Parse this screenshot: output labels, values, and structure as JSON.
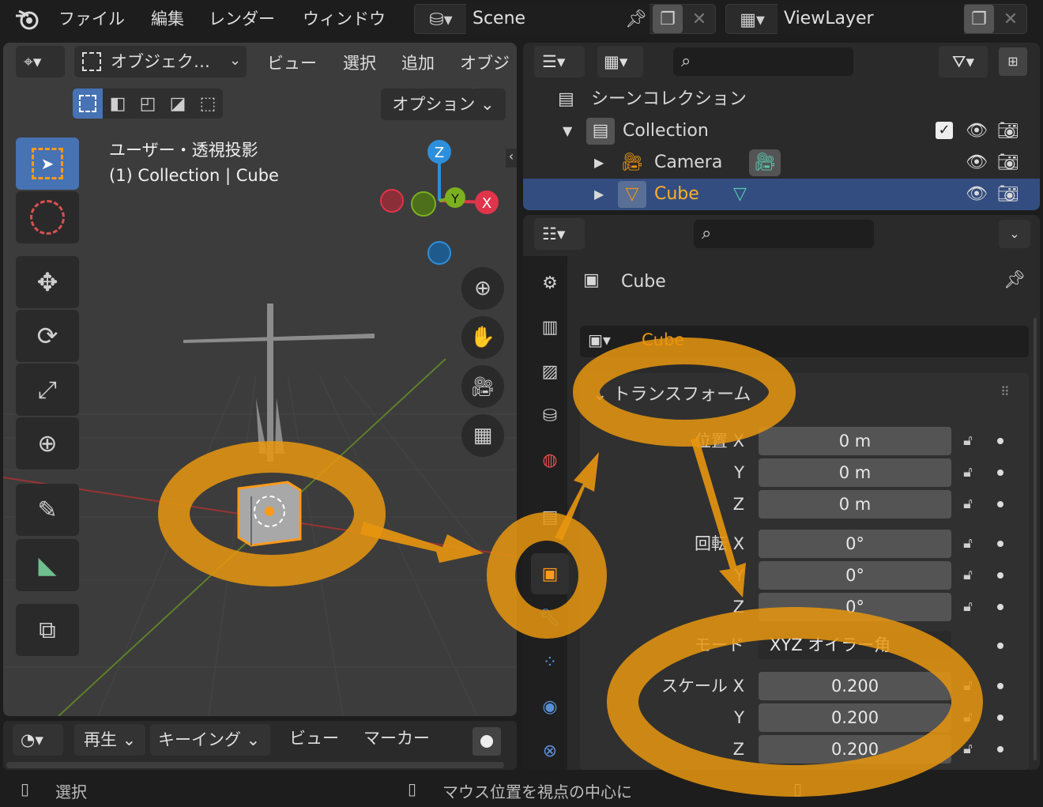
{
  "topbar": {
    "menus": [
      "ファイル",
      "編集",
      "レンダー",
      "ウィンドウ"
    ],
    "scene": "Scene",
    "view_layer": "ViewLayer"
  },
  "viewport": {
    "mode_label": "オブジェク…",
    "menus": [
      "ビュー",
      "選択",
      "追加",
      "オブジェ"
    ],
    "options_label": "オプション",
    "view_name": "ユーザー・透視投影",
    "collection_info": "(1) Collection | Cube",
    "gizmo": {
      "x": "X",
      "y": "Y",
      "z": "Z"
    }
  },
  "timeline": {
    "play_label": "再生",
    "keying_label": "キーイング",
    "view_label": "ビュー",
    "marker_label": "マーカー"
  },
  "outliner": {
    "scene_collection": "シーンコレクション",
    "collection": "Collection",
    "camera": "Camera",
    "cube": "Cube"
  },
  "properties": {
    "object_name": "Cube",
    "data_name": "Cube",
    "panel_title": "トランスフォーム",
    "location_label": "位置 X",
    "location": [
      "0 m",
      "0 m",
      "0 m"
    ],
    "rotation_label": "回転 X",
    "rotation": [
      "0°",
      "0°",
      "0°"
    ],
    "mode_label": "モード",
    "mode_value": "XYZ オイラー角",
    "scale_label": "スケール X",
    "scale": [
      "0.200",
      "0.200",
      "0.200"
    ],
    "axis_y": "Y",
    "axis_z": "Z"
  },
  "statusbar": {
    "left": "選択",
    "center": "マウス位置を視点の中心に"
  },
  "colors": {
    "accent_orange": "#e8960f",
    "selection_blue": "#334d80",
    "axis_x": "#e0344b",
    "axis_y": "#7bb01f",
    "axis_z": "#2d8fdc"
  }
}
